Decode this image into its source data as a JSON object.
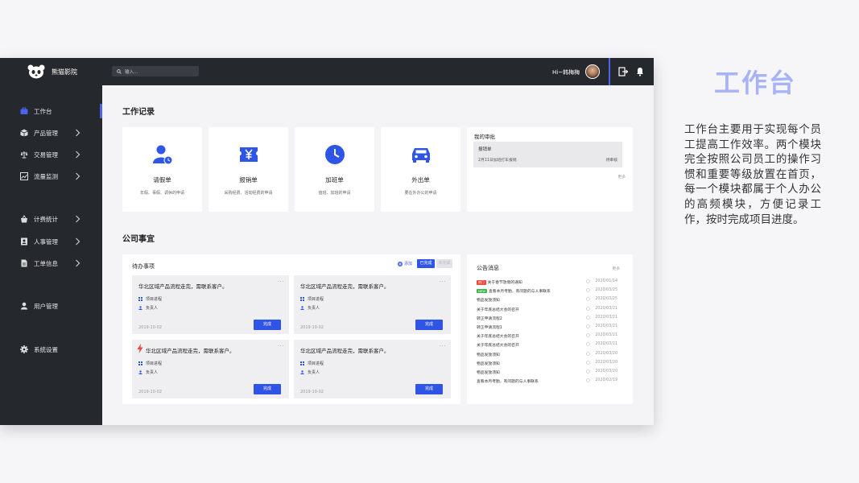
{
  "app": {
    "brand": "熊猫影院",
    "search_placeholder": "输入...",
    "greeting": "Hi~韩梅梅"
  },
  "sidebar": {
    "items": [
      {
        "label": "工作台",
        "icon": "briefcase-icon",
        "chevron": false
      },
      {
        "label": "产品管理",
        "icon": "box-icon",
        "chevron": true
      },
      {
        "label": "交易管理",
        "icon": "scale-icon",
        "chevron": true
      },
      {
        "label": "流量监测",
        "icon": "trend-icon",
        "chevron": true
      },
      {
        "label": "计费统计",
        "icon": "money-icon",
        "chevron": true
      },
      {
        "label": "人事管理",
        "icon": "contact-icon",
        "chevron": true
      },
      {
        "label": "工单信息",
        "icon": "document-icon",
        "chevron": true
      },
      {
        "label": "用户管理",
        "icon": "user-icon",
        "chevron": false
      },
      {
        "label": "系统设置",
        "icon": "gear-icon",
        "chevron": false
      }
    ]
  },
  "work_records": {
    "title": "工作记录",
    "cards": [
      {
        "title": "请假单",
        "desc": "年假、事假、调休的申请"
      },
      {
        "title": "报销单",
        "desc": "采购经费、活动经费的申请"
      },
      {
        "title": "加班单",
        "desc": "值班、加班的申请"
      },
      {
        "title": "外出单",
        "desc": "要在外办公的申请"
      }
    ],
    "approval": {
      "title": "我的审批",
      "item_title": "报销单",
      "item_desc": "2月11日加班打车报销",
      "item_status": "待审核",
      "more": "更多"
    }
  },
  "company": {
    "title": "公司事宜",
    "todo": {
      "title": "待办事项",
      "add_label": "添加",
      "tab_done": "已完成",
      "tab_other": "未完成",
      "tasks": [
        {
          "title": "华北区域产品流程走完，需联系客户。",
          "progress": "项目进程",
          "owner": "负责人",
          "date": "2019-10-02",
          "button": "完成",
          "urgent": false
        },
        {
          "title": "华北区域产品流程走完，需联系客户。",
          "progress": "项目进程",
          "owner": "负责人",
          "date": "2019-10-02",
          "button": "完成",
          "urgent": false
        },
        {
          "title": "华北区域产品流程走完，需联系客户。",
          "progress": "项目进程",
          "owner": "负责人",
          "date": "2019-10-02",
          "button": "完成",
          "urgent": true
        },
        {
          "title": "华北区域产品流程走完，需联系客户。",
          "progress": "项目进程",
          "owner": "负责人",
          "date": "2019-10-02",
          "button": "完成",
          "urgent": false
        }
      ]
    },
    "notices": {
      "title": "公告消息",
      "more": "更多",
      "badge_colors": {
        "hot": "#e8453c",
        "new": "#3bb54a"
      },
      "items": [
        {
          "badge": "热门",
          "badge_type": "hot",
          "text": "关于春节放假的通知",
          "date": "2020/01/14"
        },
        {
          "badge": "NEW",
          "badge_type": "new",
          "text": "查看本月考勤，有问题的与人事联系",
          "date": "2020/03/25"
        },
        {
          "badge": "",
          "badge_type": "",
          "text": "物品发放须知",
          "date": "2020/03/25"
        },
        {
          "badge": "",
          "badge_type": "",
          "text": "关于年底总结大会的召开",
          "date": "2020/03/21"
        },
        {
          "badge": "",
          "badge_type": "",
          "text": "转正申请流程2",
          "date": "2020/03/21"
        },
        {
          "badge": "",
          "badge_type": "",
          "text": "转正申请流程1",
          "date": "2020/03/21"
        },
        {
          "badge": "",
          "badge_type": "",
          "text": "关于年底总结大会的召开",
          "date": "2020/03/21"
        },
        {
          "badge": "",
          "badge_type": "",
          "text": "关于年底总结大会的召开",
          "date": "2020/03/21"
        },
        {
          "badge": "",
          "badge_type": "",
          "text": "物品发放须知",
          "date": "2020/03/20"
        },
        {
          "badge": "",
          "badge_type": "",
          "text": "物品发放须知",
          "date": "2020/03/20"
        },
        {
          "badge": "",
          "badge_type": "",
          "text": "物品发放须知",
          "date": "2020/03/20"
        },
        {
          "badge": "",
          "badge_type": "",
          "text": "查看本月考勤，有问题的与人事联系",
          "date": "2020/02/19"
        }
      ]
    }
  },
  "slide": {
    "heading": "工作台",
    "description": "工作台主要用于实现每个员工提高工作效率。两个模块完全按照公司员工的操作习惯和重要等级放置在首页，每一个模块都属于个人办公的高频模块，方便记录工作，按时完成项目进度。"
  },
  "colors": {
    "accent": "#2e55e6",
    "dark": "#25282d",
    "heading": "#a7b3f5"
  }
}
